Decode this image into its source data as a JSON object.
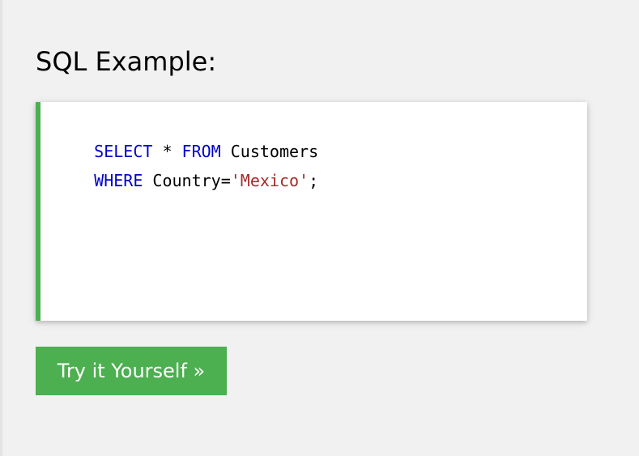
{
  "page": {
    "title": "SQL Example:"
  },
  "code_example": {
    "accent_color": "#4caf50",
    "keyword_color": "#0000cd",
    "string_color": "#a52a2a",
    "lines": [
      [
        {
          "text": "SELECT",
          "kind": "keyword"
        },
        {
          "text": " * ",
          "kind": "plain"
        },
        {
          "text": "FROM",
          "kind": "keyword"
        },
        {
          "text": " Customers",
          "kind": "plain"
        }
      ],
      [
        {
          "text": "WHERE",
          "kind": "keyword"
        },
        {
          "text": " Country=",
          "kind": "plain"
        },
        {
          "text": "'Mexico'",
          "kind": "string"
        },
        {
          "text": ";",
          "kind": "plain"
        }
      ]
    ]
  },
  "actions": {
    "try_button_label": "Try it Yourself »",
    "try_button_color": "#4caf50"
  }
}
